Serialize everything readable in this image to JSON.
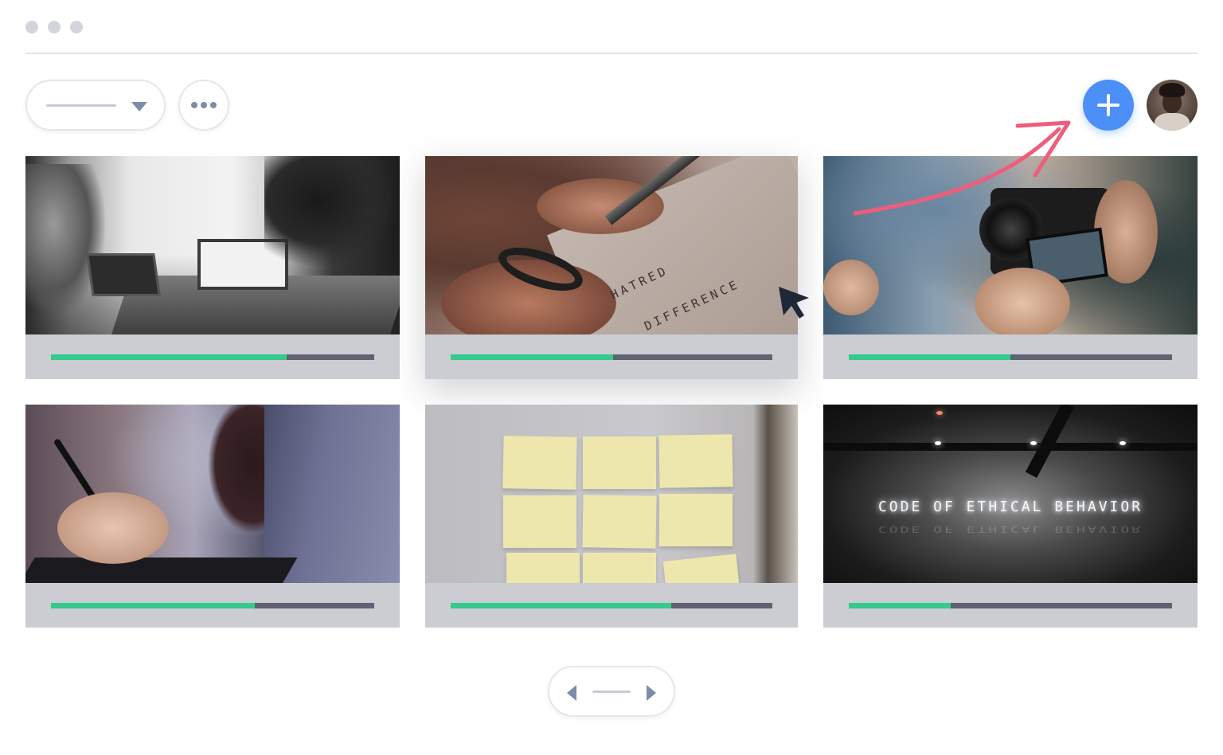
{
  "window": {
    "dots": [
      "window-dot",
      "window-dot",
      "window-dot"
    ]
  },
  "toolbar": {
    "dropdown_icon": "chevron-down-icon",
    "more_icon": "more-dots-icon",
    "add_icon": "plus-icon",
    "add_color": "#4b8ff7",
    "avatar": "user-avatar"
  },
  "cards": [
    {
      "image": "office-monochrome-photo",
      "progress": 0.73
    },
    {
      "image": "scissors-cutting-paper-photo",
      "progress": 0.505
    },
    {
      "image": "camera-in-hands-photo",
      "progress": 0.5
    },
    {
      "image": "drawing-tablet-photo",
      "progress": 0.63
    },
    {
      "image": "sticky-notes-wall-photo",
      "progress": 0.685
    },
    {
      "image": "neon-sign-photo",
      "progress": 0.315,
      "neon_text": "CODE OF ETHICAL BEHAVIOR"
    }
  ],
  "scissors_paper_text": [
    "HATRED",
    "DIFFERENCE"
  ],
  "colors": {
    "progress_fill": "#35c98d",
    "progress_track": "#5e6273",
    "card_footer": "#cbcdd2",
    "annotation_arrow": "#ef5d7c",
    "icon": "#7d8da8"
  },
  "pager": {
    "prev_icon": "chevron-left-icon",
    "next_icon": "chevron-right-icon"
  }
}
